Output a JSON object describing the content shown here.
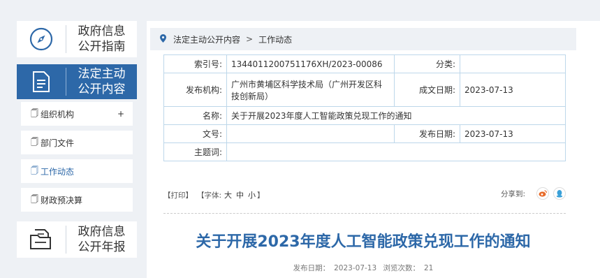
{
  "sidebar": {
    "guide_card": {
      "line1": "政府信息",
      "line2": "公开指南",
      "icon": "compass-icon"
    },
    "active_card": {
      "line1": "法定主动",
      "line2": "公开内容",
      "icon": "document-icon"
    },
    "menu": [
      {
        "label": "组织机构",
        "has_expand": true,
        "expand_symbol": "+"
      },
      {
        "label": "部门文件",
        "has_expand": false
      },
      {
        "label": "工作动态",
        "has_expand": false,
        "current": true
      },
      {
        "label": "财政预决算",
        "has_expand": false
      }
    ],
    "report_card": {
      "line1": "政府信息",
      "line2": "公开年报",
      "icon": "folder-document-icon"
    }
  },
  "breadcrumb": {
    "item1": "法定主动公开内容",
    "separator": ">",
    "item2": "工作动态"
  },
  "meta": {
    "index_label": "索引号:",
    "index_value": "1344011200751176XH/2023-00086",
    "category_label": "分类:",
    "category_value": "",
    "publisher_label": "发布机构:",
    "publisher_value": "广州市黄埔区科学技术局（广州开发区科技创新局）",
    "created_label": "成文日期:",
    "created_value": "2023-07-13",
    "name_label": "名称:",
    "name_value": "关于开展2023年度人工智能政策兑现工作的通知",
    "docno_label": "文号:",
    "docno_value": "",
    "published_label": "发布日期:",
    "published_value": "2023-07-13",
    "subject_label": "主题词:",
    "subject_value": ""
  },
  "tools": {
    "print": "【打印】",
    "font_prefix": "【字体:",
    "font_large": "大",
    "font_medium": "中",
    "font_small": "小",
    "font_suffix": "】",
    "share_label": "分享到:"
  },
  "article": {
    "title": "关于开展2023年度人工智能政策兑现工作的通知",
    "pub_label": "发布日期：",
    "pub_date": "2023-07-13",
    "views_label": "浏览次数：",
    "views": "21"
  },
  "colors": {
    "accent": "#2d68a8",
    "background": "#eef1f5",
    "table_border": "#bdd7ea",
    "weibo": "#e86b2a",
    "qq": "#3aa0d8"
  }
}
